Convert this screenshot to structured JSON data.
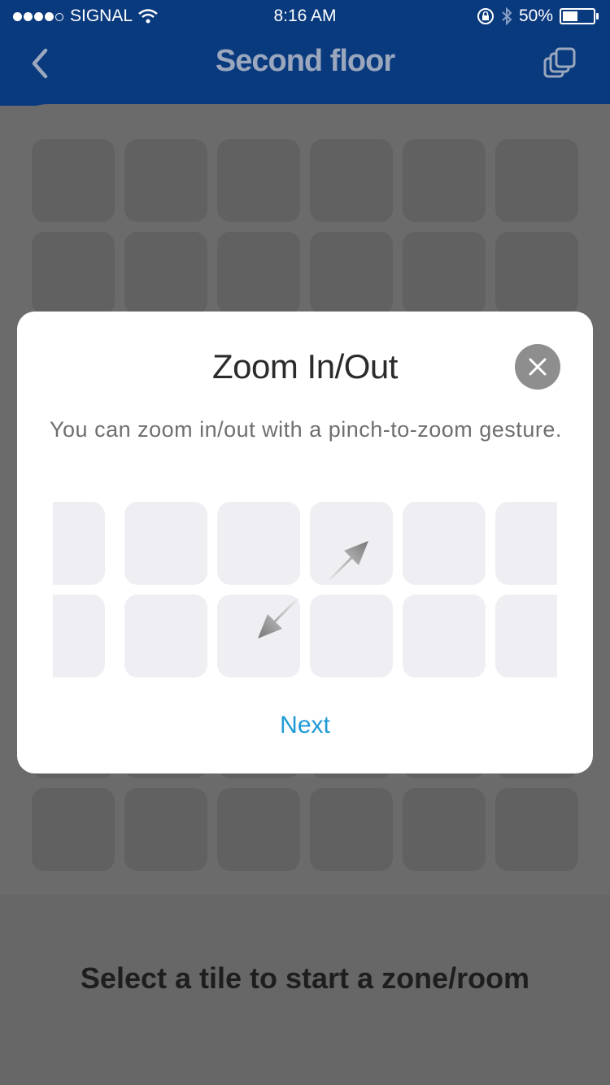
{
  "status_bar": {
    "carrier": "SIGNAL",
    "time": "8:16 AM",
    "battery": "50%",
    "signal_bars_filled": 4,
    "signal_bars_total": 5
  },
  "navbar": {
    "title": "Second floor",
    "back_icon": "chevron-left-icon",
    "action_icon": "layers-icon"
  },
  "modal": {
    "title": "Zoom In/Out",
    "description": "You can zoom in/out with a pinch-to-zoom gesture.",
    "close_icon": "close-icon",
    "next_label": "Next"
  },
  "footer": {
    "message": "Select a tile to start a zone/room"
  },
  "colors": {
    "navbar": "#0a3a7e",
    "accent": "#1e9bd7",
    "overlay": "#6b6b6b"
  }
}
